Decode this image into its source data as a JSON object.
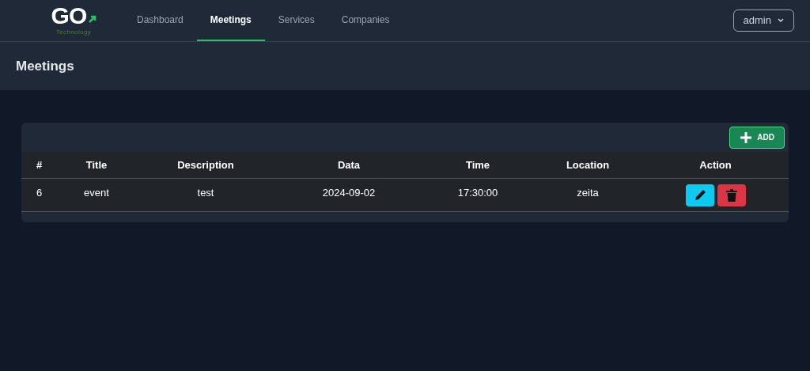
{
  "brand": {
    "logo": "GO",
    "tagline": "Technology"
  },
  "nav": [
    {
      "label": "Dashboard",
      "selected": false
    },
    {
      "label": "Meetings",
      "selected": true
    },
    {
      "label": "Services",
      "selected": false
    },
    {
      "label": "Companies",
      "selected": false
    }
  ],
  "user_menu": {
    "label": "admin"
  },
  "page_title": "Meetings",
  "add_button": {
    "label": "ADD"
  },
  "table": {
    "columns": [
      "#",
      "Title",
      "Description",
      "Data",
      "Time",
      "Location",
      "Action"
    ],
    "rows": [
      {
        "cells": [
          "6",
          "event",
          "test",
          "2024-09-02",
          "17:30:00",
          "zeita"
        ]
      }
    ]
  }
}
